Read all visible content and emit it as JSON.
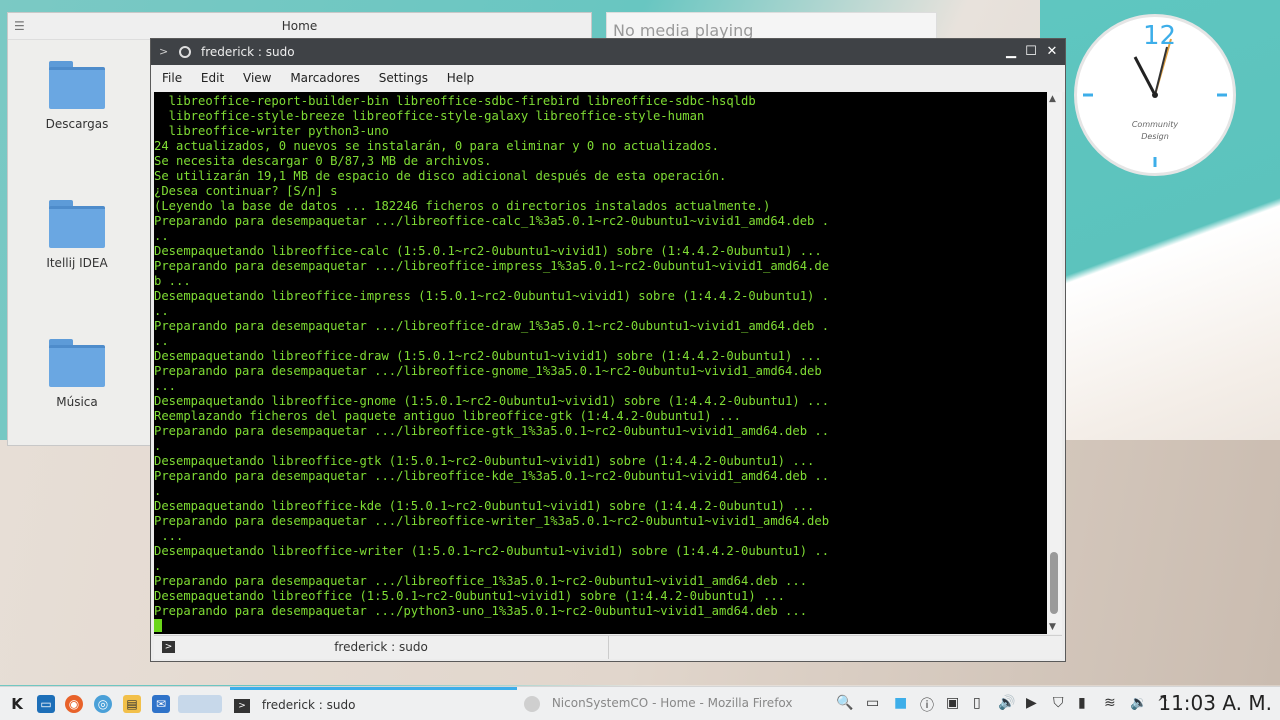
{
  "file_window": {
    "title": "Home",
    "folders": [
      {
        "label": "Descargas"
      },
      {
        "label": "Itellij IDEA"
      },
      {
        "label": "Música"
      }
    ]
  },
  "media_widget": {
    "text": "No media playing"
  },
  "clock_widget": {
    "number": "12",
    "brand_line1": "Community",
    "brand_line2": "Design"
  },
  "terminal": {
    "title": "frederick : sudo",
    "menu": [
      "File",
      "Edit",
      "View",
      "Marcadores",
      "Settings",
      "Help"
    ],
    "lines": [
      "  libreoffice-report-builder-bin libreoffice-sdbc-firebird libreoffice-sdbc-hsqldb",
      "  libreoffice-style-breeze libreoffice-style-galaxy libreoffice-style-human",
      "  libreoffice-writer python3-uno",
      "24 actualizados, 0 nuevos se instalarán, 0 para eliminar y 0 no actualizados.",
      "Se necesita descargar 0 B/87,3 MB de archivos.",
      "Se utilizarán 19,1 MB de espacio de disco adicional después de esta operación.",
      "¿Desea continuar? [S/n] s",
      "(Leyendo la base de datos ... 182246 ficheros o directorios instalados actualmente.)",
      "Preparando para desempaquetar .../libreoffice-calc_1%3a5.0.1~rc2-0ubuntu1~vivid1_amd64.deb .",
      "..",
      "Desempaquetando libreoffice-calc (1:5.0.1~rc2-0ubuntu1~vivid1) sobre (1:4.4.2-0ubuntu1) ...",
      "Preparando para desempaquetar .../libreoffice-impress_1%3a5.0.1~rc2-0ubuntu1~vivid1_amd64.de",
      "b ...",
      "Desempaquetando libreoffice-impress (1:5.0.1~rc2-0ubuntu1~vivid1) sobre (1:4.4.2-0ubuntu1) .",
      "..",
      "Preparando para desempaquetar .../libreoffice-draw_1%3a5.0.1~rc2-0ubuntu1~vivid1_amd64.deb .",
      "..",
      "Desempaquetando libreoffice-draw (1:5.0.1~rc2-0ubuntu1~vivid1) sobre (1:4.4.2-0ubuntu1) ...",
      "Preparando para desempaquetar .../libreoffice-gnome_1%3a5.0.1~rc2-0ubuntu1~vivid1_amd64.deb",
      "...",
      "Desempaquetando libreoffice-gnome (1:5.0.1~rc2-0ubuntu1~vivid1) sobre (1:4.4.2-0ubuntu1) ...",
      "Reemplazando ficheros del paquete antiguo libreoffice-gtk (1:4.4.2-0ubuntu1) ...",
      "Preparando para desempaquetar .../libreoffice-gtk_1%3a5.0.1~rc2-0ubuntu1~vivid1_amd64.deb ..",
      ".",
      "Desempaquetando libreoffice-gtk (1:5.0.1~rc2-0ubuntu1~vivid1) sobre (1:4.4.2-0ubuntu1) ...",
      "Preparando para desempaquetar .../libreoffice-kde_1%3a5.0.1~rc2-0ubuntu1~vivid1_amd64.deb ..",
      ".",
      "Desempaquetando libreoffice-kde (1:5.0.1~rc2-0ubuntu1~vivid1) sobre (1:4.4.2-0ubuntu1) ...",
      "Preparando para desempaquetar .../libreoffice-writer_1%3a5.0.1~rc2-0ubuntu1~vivid1_amd64.deb",
      " ...",
      "Desempaquetando libreoffice-writer (1:5.0.1~rc2-0ubuntu1~vivid1) sobre (1:4.4.2-0ubuntu1) ..",
      ".",
      "Preparando para desempaquetar .../libreoffice_1%3a5.0.1~rc2-0ubuntu1~vivid1_amd64.deb ...",
      "Desempaquetando libreoffice (1:5.0.1~rc2-0ubuntu1~vivid1) sobre (1:4.4.2-0ubuntu1) ...",
      "Preparando para desempaquetar .../python3-uno_1%3a5.0.1~rc2-0ubuntu1~vivid1_amd64.deb ..."
    ],
    "tab_label": "frederick : sudo",
    "text_color": "#7fdc34"
  },
  "taskbar": {
    "tasks": [
      {
        "label": "frederick : sudo",
        "active": true
      },
      {
        "label": "NiconSystemCO - Home - Mozilla Firefox",
        "active": false
      }
    ],
    "time": "11:03 A. M."
  }
}
